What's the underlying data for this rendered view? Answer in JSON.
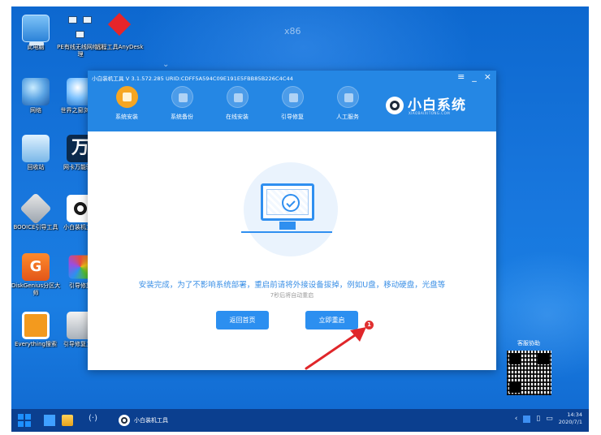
{
  "desktop": {
    "watermark": "x86",
    "icons": [
      {
        "label": "此电脑",
        "icon": "computer-icon"
      },
      {
        "label": "PE有线无线网络管理",
        "icon": "network-manager-icon"
      },
      {
        "label": "远程工具AnyDesk",
        "icon": "anydesk-icon"
      },
      {
        "label": "网络",
        "icon": "network-globe-icon"
      },
      {
        "label": "世界之窗浏览器",
        "icon": "browser-icon"
      },
      {
        "label": "回收站",
        "icon": "recycle-bin-icon"
      },
      {
        "label": "网卡万能驱动",
        "icon": "driver-icon"
      },
      {
        "label": "BOOICE引导工具",
        "icon": "booice-icon"
      },
      {
        "label": "小白装机工具",
        "icon": "xiaobai-icon"
      },
      {
        "label": "DiskGenius分区大师",
        "icon": "diskgenius-icon"
      },
      {
        "label": "引导修复",
        "icon": "boot-repair-icon"
      },
      {
        "label": "Everything搜索",
        "icon": "everything-icon"
      },
      {
        "label": "引导修复工具",
        "icon": "boot-fix-icon"
      }
    ]
  },
  "app": {
    "title": "小白装机工具 V 3.1.572.285 URID:CDFF5A594C09E191E5FBB85B226C4C44",
    "window_buttons": {
      "menu": "≡",
      "minimize": "_",
      "close": "×"
    },
    "nav": [
      {
        "label": "系统安装",
        "active": true
      },
      {
        "label": "系统备份",
        "active": false
      },
      {
        "label": "在线安装",
        "active": false
      },
      {
        "label": "引导修复",
        "active": false
      },
      {
        "label": "人工服务",
        "active": false
      }
    ],
    "brand": {
      "name": "小白系统",
      "sub": "XIAOBAIXITONG.COM"
    },
    "message": "安装完成，为了不影响系统部署，重启前请将外接设备拔掉，例如U盘，移动硬盘，光盘等",
    "countdown": "7秒后将自动重启",
    "buttons": {
      "back": "返回首页",
      "restart": "立即重启"
    },
    "badge": "1"
  },
  "side": {
    "qr_label": "客服协助"
  },
  "taskbar": {
    "app_label": "小白装机工具",
    "time": "14:34",
    "date": "2020/7/1"
  },
  "colors": {
    "accent": "#2c8ff0",
    "header": "#2587e4",
    "active_nav": "#f6a623",
    "badge": "#e03030",
    "arrow": "#e0262a"
  }
}
